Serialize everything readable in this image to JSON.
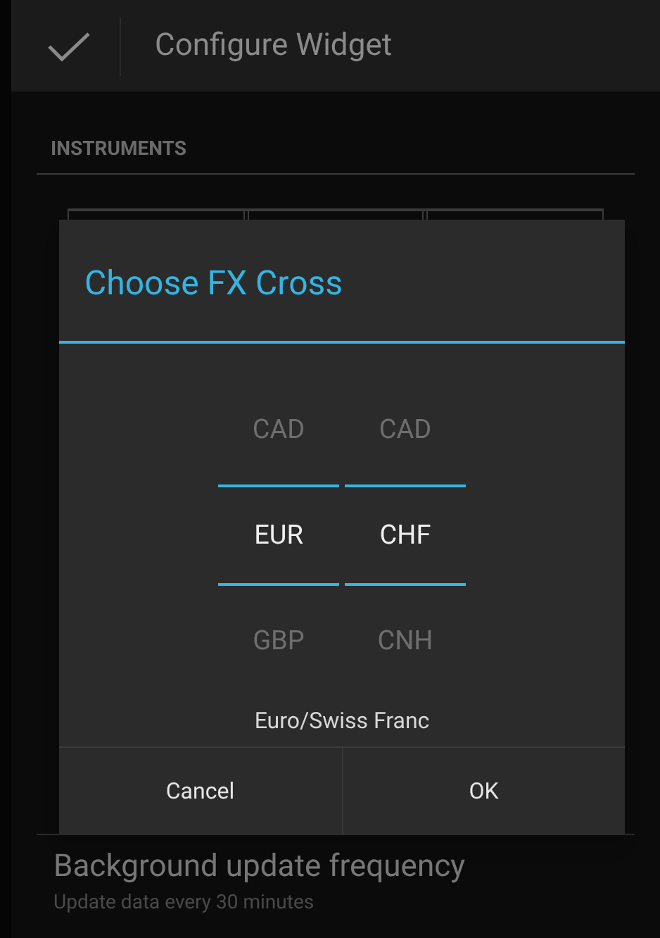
{
  "action_bar": {
    "title": "Configure Widget"
  },
  "section": {
    "header": "INSTRUMENTS"
  },
  "dialog": {
    "title": "Choose FX Cross",
    "pickers": [
      {
        "items": [
          {
            "text": "CAD",
            "selected": false
          },
          {
            "text": "EUR",
            "selected": true
          },
          {
            "text": "GBP",
            "selected": false
          }
        ]
      },
      {
        "items": [
          {
            "text": "CAD",
            "selected": false
          },
          {
            "text": "CHF",
            "selected": true
          },
          {
            "text": "CNH",
            "selected": false
          }
        ]
      }
    ],
    "description": "Euro/Swiss Franc",
    "buttons": [
      "Cancel",
      "OK"
    ]
  },
  "setting": {
    "title": "Background update frequency",
    "summary": "Update data every 30 minutes"
  }
}
